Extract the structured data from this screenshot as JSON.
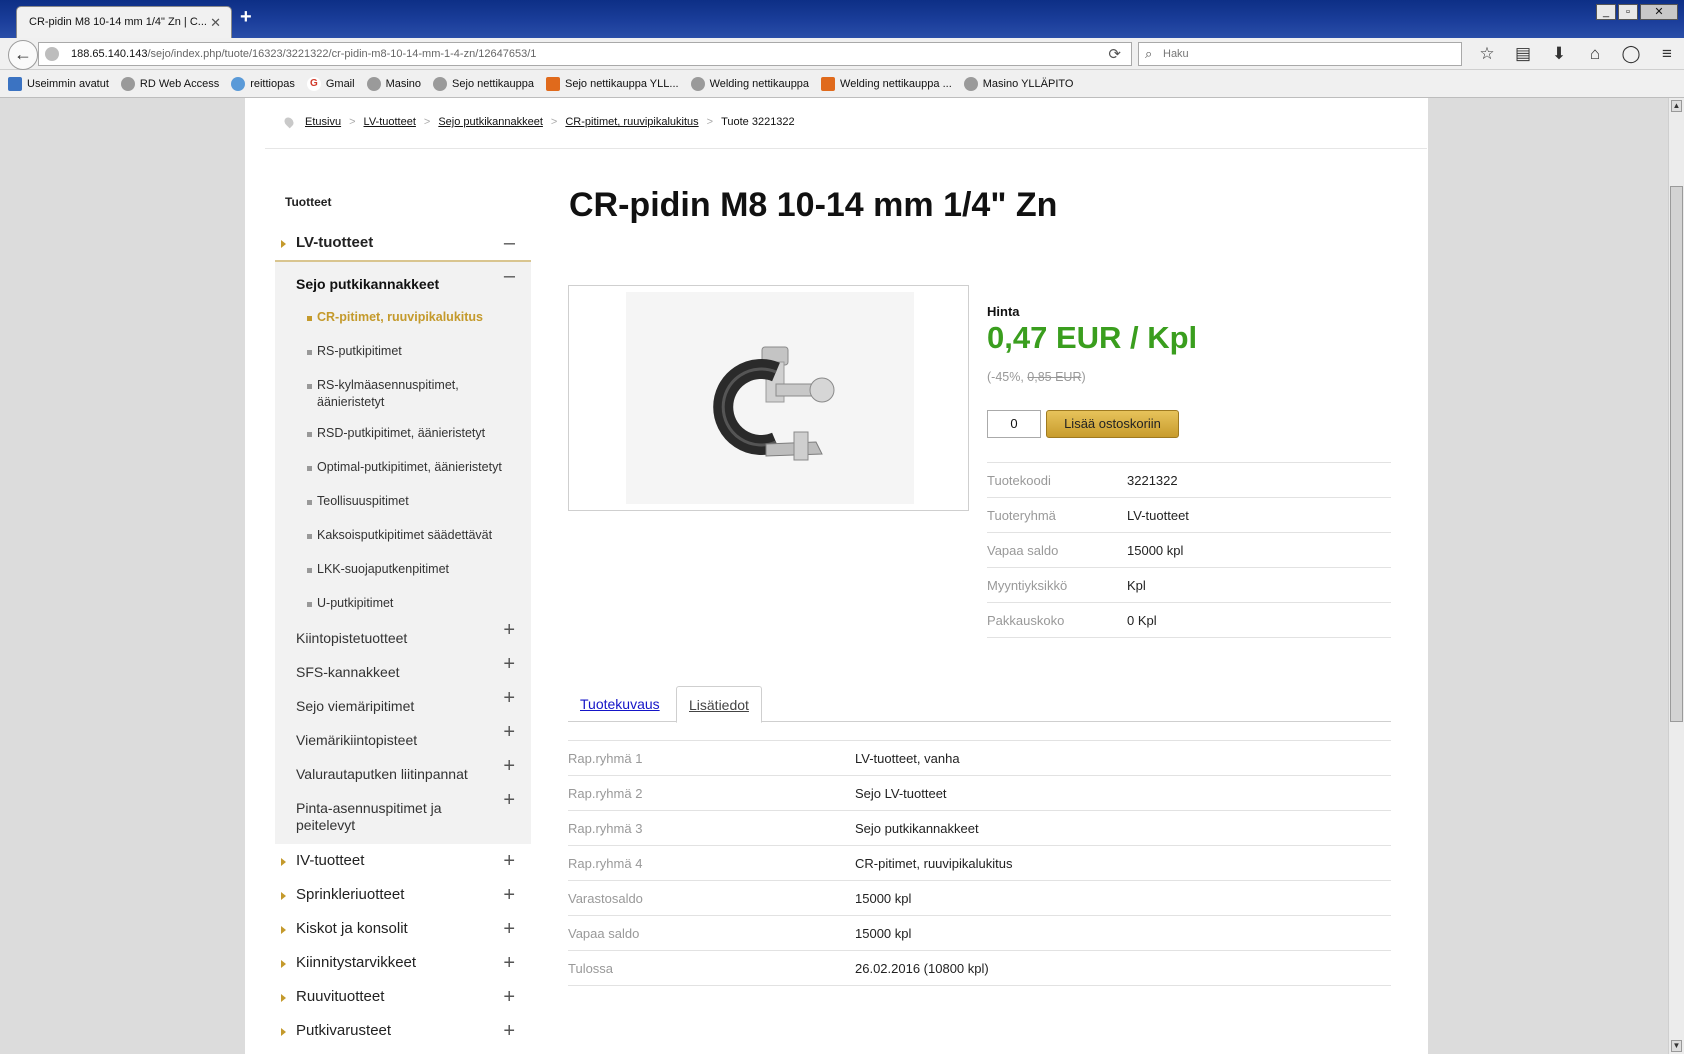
{
  "browser": {
    "tab_title": "CR-pidin M8 10-14 mm 1/4\" Zn | C...",
    "tab_close": "✕",
    "new_tab": "+",
    "url_host": "188.65.140.143",
    "url_path": "/sejo/index.php/tuote/16323/3221322/cr-pidin-m8-10-14-mm-1-4-zn/12647653/1",
    "search_placeholder": "Haku",
    "window_controls": [
      "_",
      "▫",
      "✕"
    ],
    "bookmarks": [
      {
        "label": "Useimmin avatut",
        "icon": "most-visited-icon"
      },
      {
        "label": "RD Web Access",
        "icon": "globe-icon"
      },
      {
        "label": "reittiopas",
        "icon": "sun-icon"
      },
      {
        "label": "Gmail",
        "icon": "google-icon"
      },
      {
        "label": "Masino",
        "icon": "globe-icon"
      },
      {
        "label": "Sejo nettikauppa",
        "icon": "globe-icon"
      },
      {
        "label": "Sejo nettikauppa YLL...",
        "icon": "joomla-icon"
      },
      {
        "label": "Welding nettikauppa",
        "icon": "globe-icon"
      },
      {
        "label": "Welding nettikauppa ...",
        "icon": "joomla-icon"
      },
      {
        "label": "Masino YLLÄPITO",
        "icon": "globe-icon"
      }
    ]
  },
  "breadcrumb": [
    "Etusivu",
    "LV-tuotteet",
    "Sejo putkikannakkeet",
    "CR-pitimet, ruuvipikalukitus",
    "Tuote 3221322"
  ],
  "sidebar": {
    "heading": "Tuotteet",
    "top_open": {
      "label": "LV-tuotteet",
      "toggle": "–"
    },
    "sub_open": {
      "label": "Sejo putkikannakkeet",
      "toggle": "–"
    },
    "leaf_items": [
      {
        "label": "CR-pitimet, ruuvipikalukitus",
        "active": true
      },
      {
        "label": "RS-putkipitimet",
        "active": false
      },
      {
        "label": "RS-kylmäasennuspitimet, äänieristetyt",
        "active": false
      },
      {
        "label": "RSD-putkipitimet, äänieristetyt",
        "active": false
      },
      {
        "label": "Optimal-putkipitimet, äänieristetyt",
        "active": false
      },
      {
        "label": "Teollisuuspitimet",
        "active": false
      },
      {
        "label": "Kaksoisputkipitimet säädettävät",
        "active": false
      },
      {
        "label": "LKK-suojaputkenpitimet",
        "active": false
      },
      {
        "label": "U-putkipitimet",
        "active": false
      }
    ],
    "sub_items": [
      "Kiintopistetuotteet",
      "SFS-kannakkeet",
      "Sejo viemäripitimet",
      "Viemärikiintopisteet",
      "Valurautaputken liitinpannat",
      "Pinta-asennuspitimet ja peitelevyt"
    ],
    "top_items": [
      "IV-tuotteet",
      "Sprinkleriuotteet",
      "Kiskot ja konsolit",
      "Kiinnitystarvikkeet",
      "Ruuvituotteet",
      "Putkivarusteet"
    ],
    "expand_symbol": "+"
  },
  "product": {
    "title": "CR-pidin M8 10-14 mm 1/4\" Zn",
    "price_label": "Hinta",
    "price": "0,47 EUR / Kpl",
    "discount_prefix": "(-45%, ",
    "old_price": "0,85 EUR",
    "discount_suffix": ")",
    "quantity": "0",
    "add_to_cart": "Lisää ostoskoriin",
    "properties": [
      {
        "key": "Tuotekoodi",
        "value": "3221322"
      },
      {
        "key": "Tuoteryhmä",
        "value": "LV-tuotteet"
      },
      {
        "key": "Vapaa saldo",
        "value": "15000 kpl"
      },
      {
        "key": "Myyntiyksikkö",
        "value": "Kpl"
      },
      {
        "key": "Pakkauskoko",
        "value": "0 Kpl"
      }
    ]
  },
  "tabs": [
    {
      "label": "Tuotekuvaus",
      "active": false
    },
    {
      "label": "Lisätiedot",
      "active": true
    }
  ],
  "details": [
    {
      "key": "Rap.ryhmä 1",
      "value": "LV-tuotteet, vanha"
    },
    {
      "key": "Rap.ryhmä 2",
      "value": "Sejo LV-tuotteet"
    },
    {
      "key": "Rap.ryhmä 3",
      "value": "Sejo putkikannakkeet"
    },
    {
      "key": "Rap.ryhmä 4",
      "value": "CR-pitimet, ruuvipikalukitus"
    },
    {
      "key": "Varastosaldo",
      "value": "15000 kpl"
    },
    {
      "key": "Vapaa saldo",
      "value": "15000 kpl"
    },
    {
      "key": "Tulossa",
      "value": "26.02.2016 (10800 kpl)"
    }
  ],
  "colors": {
    "accent_gold": "#c49a2c",
    "price_green": "#3a9e1e",
    "link_blue": "#1515c8"
  }
}
